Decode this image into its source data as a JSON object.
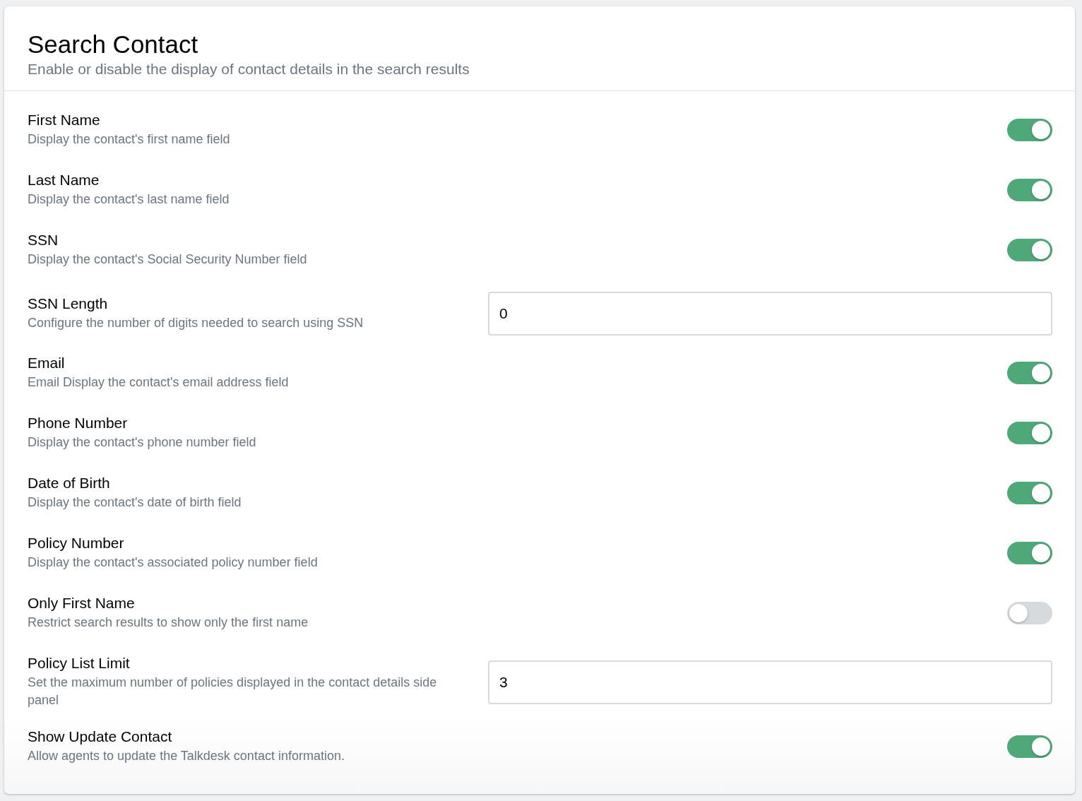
{
  "header": {
    "title": "Search Contact",
    "subtitle": "Enable or disable the display of contact details in the search results"
  },
  "settings": [
    {
      "kind": "toggle",
      "label": "First Name",
      "description": "Display the contact's first name field",
      "on": true
    },
    {
      "kind": "toggle",
      "label": "Last Name",
      "description": "Display the contact's last name field",
      "on": true
    },
    {
      "kind": "toggle",
      "label": "SSN",
      "description": "Display the contact's Social Security Number field",
      "on": true
    },
    {
      "kind": "input",
      "label": "SSN Length",
      "description": "Configure the number of digits needed to search using SSN",
      "value": "0"
    },
    {
      "kind": "toggle",
      "label": "Email",
      "description": "Email Display the contact's email address field",
      "on": true
    },
    {
      "kind": "toggle",
      "label": "Phone Number",
      "description": "Display the contact's phone number field",
      "on": true
    },
    {
      "kind": "toggle",
      "label": "Date of Birth",
      "description": "Display the contact's date of birth field",
      "on": true
    },
    {
      "kind": "toggle",
      "label": "Policy Number",
      "description": "Display the contact's associated policy number field",
      "on": true
    },
    {
      "kind": "toggle",
      "label": "Only First Name",
      "description": "Restrict search results to show only the first name",
      "on": false
    },
    {
      "kind": "input",
      "label": "Policy List Limit",
      "description": "Set the maximum number of policies displayed in the contact details side panel",
      "value": "3"
    },
    {
      "kind": "toggle",
      "label": "Show Update Contact",
      "description": "Allow agents to update the Talkdesk contact information.",
      "on": true
    }
  ]
}
